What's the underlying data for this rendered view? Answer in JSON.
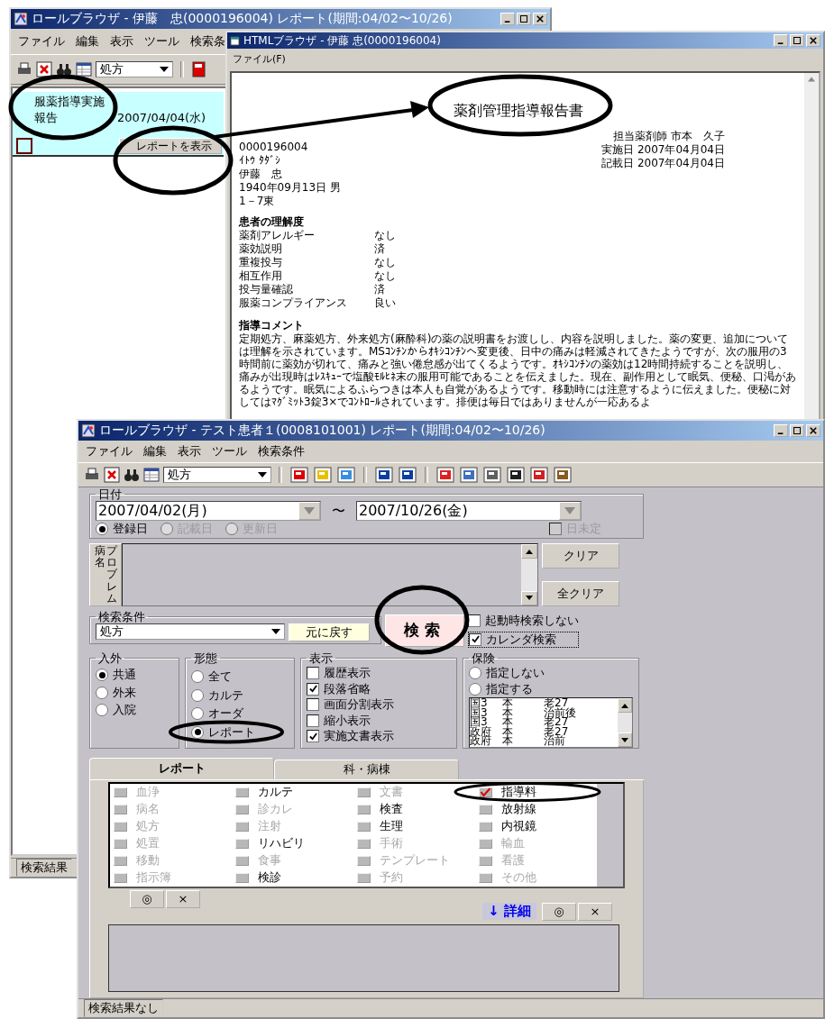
{
  "back_window": {
    "title": "ロールブラウザ - 伊藤　忠(0000196004) レポート(期間:04/02〜10/26)",
    "menu": [
      "ファイル",
      "編集",
      "表示",
      "ツール",
      "検索条"
    ],
    "toolbar_combo": "処方",
    "rows": [
      {
        "name": "服薬指導実施報告",
        "date": "2007/04/04(水)",
        "button": "レポートを表示",
        "selected": true
      }
    ],
    "status_bar": "検索結果"
  },
  "html_window": {
    "title": "HTMLブラウザ - 伊藤 忠(0000196004)",
    "menu": [
      "ファイル(F)"
    ],
    "report": {
      "title": "薬剤管理指導報告書",
      "patient_lines": [
        "0000196004",
        "ｲﾄｳ ﾀﾀﾞｼ",
        "伊藤　忠",
        "1940年09月13日 男",
        "1－7東"
      ],
      "staff_lines": [
        "担当薬剤師 市本　久子",
        "実施日 2007年04月04日",
        "記載日 2007年04月04日"
      ],
      "section_title": "患者の理解度",
      "items": [
        {
          "label": "薬剤アレルギー",
          "value": "なし"
        },
        {
          "label": "薬効説明",
          "value": "済"
        },
        {
          "label": "重複投与",
          "value": "なし"
        },
        {
          "label": "相互作用",
          "value": "なし"
        },
        {
          "label": "投与量確認",
          "value": "済"
        },
        {
          "label": "服薬コンプライアンス",
          "value": "良い"
        }
      ],
      "comment_title": "指導コメント",
      "comment": "定期処方、麻薬処方、外来処方(麻酔科)の薬の説明書をお渡しし、内容を説明しました。薬の変更、追加については理解を示されています。MSｺﾝﾁﾝからｵｷｼｺﾝﾁﾝへ変更後、日中の痛みは軽減されてきたようですが、次の服用の3時間前に薬効が切れて、痛みと強い倦怠感が出てくるようです。ｵｷｼｺﾝﾁﾝの薬効は12時間持続することを説明し、痛みが出現時はﾚｽｷｭｰで塩酸ﾓﾙﾋﾈ末の服用可能であることを伝えました。現在、副作用として眠気、便秘、口渇があるようです。眠気によるふらつきは本人も自覚があるようです。移動時には注意するように伝えました。便秘に対してはﾏｸﾞﾐｯﾄ3錠3×でｺﾝﾄﾛｰﾙされています。排便は毎日ではありませんが一応あるよ"
    }
  },
  "front_window": {
    "title": "ロールブラウザ - テスト患者１(0008101001) レポート(期間:04/02〜10/26)",
    "menu": [
      "ファイル",
      "編集",
      "表示",
      "ツール",
      "検索条件"
    ],
    "toolbar_combo": "処方",
    "date_group": {
      "label": "日付",
      "from": "2007/04/02(月)",
      "separator": "〜",
      "to": "2007/10/26(金)",
      "date_types": [
        {
          "label": "登録日",
          "selected": true,
          "disabled": false
        },
        {
          "label": "記載日",
          "selected": false,
          "disabled": true
        },
        {
          "label": "更新日",
          "selected": false,
          "disabled": true
        }
      ],
      "undetermined": {
        "label": "日未定",
        "checked": false,
        "disabled": true
      }
    },
    "problem": {
      "toggle_labels": [
        "病名",
        "プロブレム"
      ],
      "buttons": [
        "クリア",
        "全クリア"
      ]
    },
    "search": {
      "label": "検索条件",
      "combo": "処方",
      "reset_button": "元に戻す",
      "search_button": "検索",
      "options": [
        {
          "label": "起動時検索しない",
          "checked": false
        },
        {
          "label": "カレンダ検索",
          "checked": true
        }
      ]
    },
    "inout": {
      "label": "入外",
      "options": [
        {
          "label": "共通",
          "selected": true
        },
        {
          "label": "外来",
          "selected": false
        },
        {
          "label": "入院",
          "selected": false
        }
      ]
    },
    "form": {
      "label": "形態",
      "options": [
        {
          "label": "全て",
          "selected": false
        },
        {
          "label": "カルテ",
          "selected": false
        },
        {
          "label": "オーダ",
          "selected": false
        },
        {
          "label": "レポート",
          "selected": true
        }
      ]
    },
    "display": {
      "label": "表示",
      "options": [
        {
          "label": "履歴表示",
          "checked": false
        },
        {
          "label": "段落省略",
          "checked": true
        },
        {
          "label": "画面分割表示",
          "checked": false
        },
        {
          "label": "縮小表示",
          "checked": false
        },
        {
          "label": "実施文書表示",
          "checked": true
        }
      ]
    },
    "insurance": {
      "label": "保険",
      "options": [
        {
          "label": "指定しない",
          "selected": false
        },
        {
          "label": "指定する",
          "selected": false
        }
      ],
      "list": [
        [
          "国3",
          "本",
          "老27"
        ],
        [
          "国3",
          "本",
          "治前後"
        ],
        [
          "国3",
          "本",
          "老27"
        ],
        [
          "政府",
          "本",
          "老27"
        ],
        [
          "政府",
          "本",
          "治前"
        ]
      ]
    },
    "tabs": [
      {
        "label": "レポート",
        "selected": true
      },
      {
        "label": "科・病棟",
        "selected": false
      }
    ],
    "categories": [
      {
        "label": "血浄",
        "enabled": false,
        "checked": false
      },
      {
        "label": "カルテ",
        "enabled": true,
        "checked": false
      },
      {
        "label": "文書",
        "enabled": false,
        "checked": false
      },
      {
        "label": "指導料",
        "enabled": true,
        "checked": true
      },
      {
        "label": "病名",
        "enabled": false,
        "checked": false
      },
      {
        "label": "診カレ",
        "enabled": false,
        "checked": false
      },
      {
        "label": "検査",
        "enabled": true,
        "checked": false
      },
      {
        "label": "放射線",
        "enabled": true,
        "checked": false
      },
      {
        "label": "処方",
        "enabled": false,
        "checked": false
      },
      {
        "label": "注射",
        "enabled": false,
        "checked": false
      },
      {
        "label": "生理",
        "enabled": true,
        "checked": false
      },
      {
        "label": "内視鏡",
        "enabled": true,
        "checked": false
      },
      {
        "label": "処置",
        "enabled": false,
        "checked": false
      },
      {
        "label": "リハビリ",
        "enabled": true,
        "checked": false
      },
      {
        "label": "手術",
        "enabled": false,
        "checked": false
      },
      {
        "label": "輸血",
        "enabled": false,
        "checked": false
      },
      {
        "label": "移動",
        "enabled": false,
        "checked": false
      },
      {
        "label": "食事",
        "enabled": false,
        "checked": false
      },
      {
        "label": "テンプレート",
        "enabled": false,
        "checked": false
      },
      {
        "label": "看護",
        "enabled": false,
        "checked": false
      },
      {
        "label": "指示簿",
        "enabled": false,
        "checked": false
      },
      {
        "label": "検診",
        "enabled": true,
        "checked": false
      },
      {
        "label": "予約",
        "enabled": false,
        "checked": false
      },
      {
        "label": "その他",
        "enabled": false,
        "checked": false
      }
    ],
    "grid_buttons": [
      "◎",
      "×"
    ],
    "detail_link": "↓ 詳細",
    "detail_buttons": [
      "◎",
      "×"
    ],
    "status_bar": "検索結果なし"
  }
}
